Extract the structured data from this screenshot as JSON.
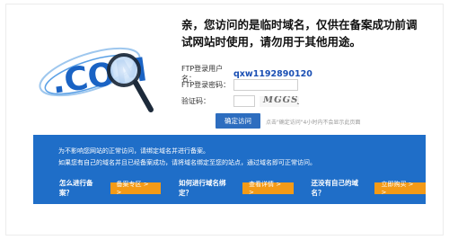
{
  "illustration": {
    "logo_text": ".COM",
    "icon": "magnifier-icon"
  },
  "headline": "亲，您访问的是临时域名，仅供在备案成功前调试网站时使用，请勿用于其他用途。",
  "form": {
    "username_label": "FTP登录用户名：",
    "username_value": "qxw1192890120",
    "password_label": "FTP登录密码：",
    "captcha_label": "验证码：",
    "captcha_text": "MGGSJ"
  },
  "visit_button": "确定访问",
  "visit_hint": "点击\"确定访问\"4小时内不会显示此页面",
  "panel": {
    "line1": "为不影响您网站的正常访问，请绑定域名并进行备案。",
    "line2": "如果您有自己的域名并且已经备案成功，请将域名绑定至您的站点，通过域名即可正常访问。",
    "q1": "怎么进行备案？",
    "b1": "备案专区 > >",
    "q2": "如何进行域名绑定？",
    "b2": "查看详情 > >",
    "q3": "还没有自己的域名？",
    "b3": "立即购买 > >"
  },
  "colors": {
    "panel_blue": "#1f6ec8",
    "accent_orange": "#f39a17",
    "button_blue": "#2d6dbf"
  }
}
